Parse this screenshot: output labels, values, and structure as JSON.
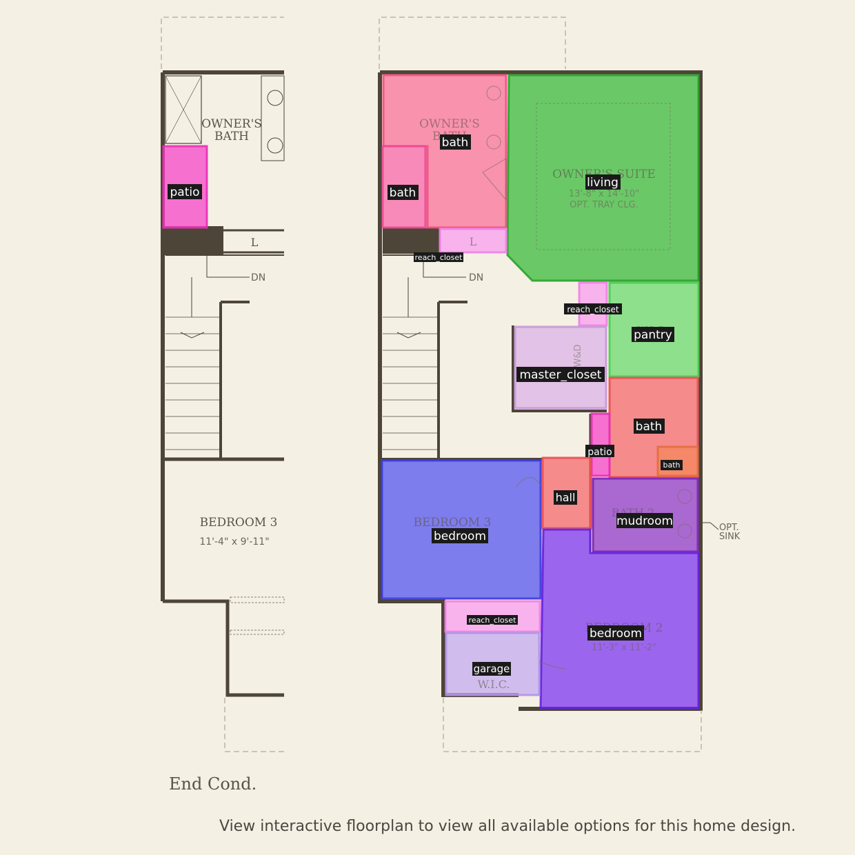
{
  "plan_labels": {
    "owners_bath": [
      "OWNER'S",
      "BATH"
    ],
    "owners_bath_right": [
      "OWNER'S",
      "BATH"
    ],
    "owners_suite": "OWNER'S SUITE",
    "owners_suite_dims": "13'-8\" x 14'-10\"",
    "owners_suite_note": "OPT. TRAY CLG.",
    "linen": "L",
    "stairs_down": "DN",
    "wic_upper": "W.I.C.",
    "wd": "W&D",
    "bath2": "BATH 2",
    "opt_sink": [
      "OPT.",
      "SINK"
    ],
    "bedroom3": "BEDROOM 3",
    "bedroom3_dims": "11'-4\" x 9'-11\"",
    "bedroom2": "BEDROOM 2",
    "bedroom2_dims": "11'-3\" x 11'-2\"",
    "wic_lower": "W.I.C.",
    "end_cond": "End Cond."
  },
  "footer": "View interactive floorplan to view all available options for this home design.",
  "legend": {
    "bath": "#fb6d95",
    "living": "#35b936",
    "reach_closet": "#f99bf0",
    "pantry": "#67d96a",
    "master_closet": "#dbb0e6",
    "patio": "#f63fc6",
    "hall": "#f56468",
    "bedroom_3": "#5050f0",
    "mudroom": "#8e33c9",
    "bedroom_2": "#7a2ff0",
    "garage": "#c4a9f0",
    "bath_small": "#f4875a"
  },
  "region_labels": [
    {
      "id": "patio-left",
      "text": "patio",
      "room_type": "patio"
    },
    {
      "id": "bath-owner",
      "text": "bath",
      "room_type": "bath"
    },
    {
      "id": "bath-owner-wc",
      "text": "bath",
      "room_type": "bath"
    },
    {
      "id": "living-suite",
      "text": "living",
      "room_type": "living"
    },
    {
      "id": "reach-closet-linen",
      "text": "reach_closet",
      "room_type": "reach_closet"
    },
    {
      "id": "reach-closet-mid",
      "text": "reach_closet",
      "room_type": "reach_closet"
    },
    {
      "id": "pantry",
      "text": "pantry",
      "room_type": "pantry"
    },
    {
      "id": "master-closet",
      "text": "master_closet",
      "room_type": "master_closet"
    },
    {
      "id": "bath-hall",
      "text": "bath",
      "room_type": "bath"
    },
    {
      "id": "patio-mid",
      "text": "patio",
      "room_type": "patio"
    },
    {
      "id": "bath-small",
      "text": "bath",
      "room_type": "bath"
    },
    {
      "id": "hall",
      "text": "hall",
      "room_type": "hall"
    },
    {
      "id": "mudroom",
      "text": "mudroom",
      "room_type": "mudroom"
    },
    {
      "id": "bedroom-3",
      "text": "bedroom",
      "room_type": "bedroom"
    },
    {
      "id": "reach-closet-lower",
      "text": "reach_closet",
      "room_type": "reach_closet"
    },
    {
      "id": "bedroom-2",
      "text": "bedroom",
      "room_type": "bedroom"
    },
    {
      "id": "garage",
      "text": "garage",
      "room_type": "garage"
    }
  ]
}
